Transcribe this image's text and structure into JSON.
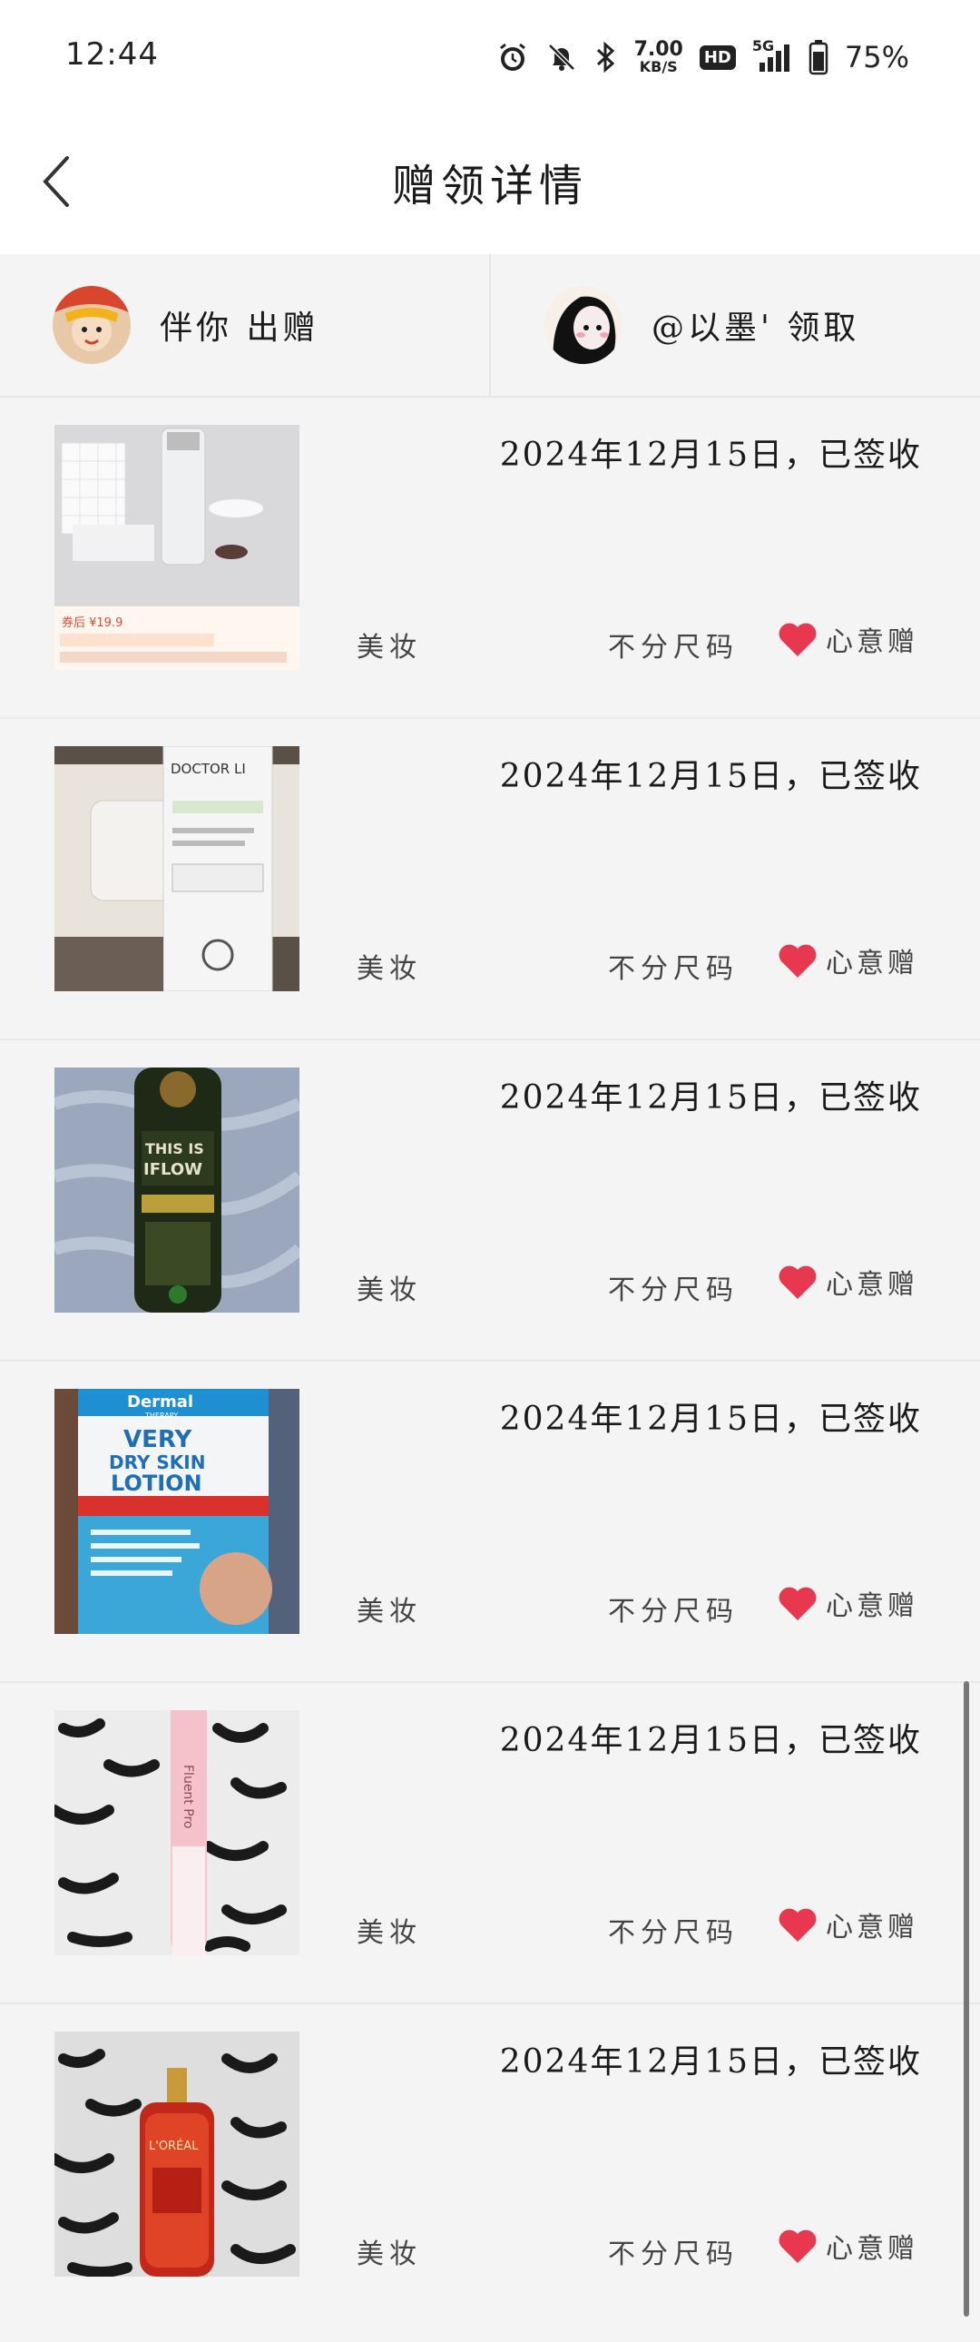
{
  "status_bar": {
    "time": "12:44",
    "speed_value": "7.00",
    "speed_unit": "KB/S",
    "hd": "HD",
    "network": "5G",
    "battery": "75%",
    "icons": [
      "alarm-icon",
      "mute-icon",
      "bluetooth-icon",
      "speed-icon",
      "hd-icon",
      "signal-icon",
      "battery-icon"
    ]
  },
  "header": {
    "title": "赠领详情",
    "back_icon": "chevron-left-icon"
  },
  "giver": {
    "text": "伴你 出赠"
  },
  "receiver": {
    "text": "@以墨' 领取"
  },
  "items": [
    {
      "date": "2024年12月15日，已签收",
      "category": "美妆",
      "size": "不分尺码",
      "gift_type": "心意赠"
    },
    {
      "date": "2024年12月15日，已签收",
      "category": "美妆",
      "size": "不分尺码",
      "gift_type": "心意赠"
    },
    {
      "date": "2024年12月15日，已签收",
      "category": "美妆",
      "size": "不分尺码",
      "gift_type": "心意赠"
    },
    {
      "date": "2024年12月15日，已签收",
      "category": "美妆",
      "size": "不分尺码",
      "gift_type": "心意赠"
    },
    {
      "date": "2024年12月15日，已签收",
      "category": "美妆",
      "size": "不分尺码",
      "gift_type": "心意赠"
    },
    {
      "date": "2024年12月15日，已签收",
      "category": "美妆",
      "size": "不分尺码",
      "gift_type": "心意赠"
    }
  ],
  "thumb_texts": {
    "doctor_li": "DOCTOR LI",
    "this_is": "THIS IS",
    "iflow": "IFLOW",
    "dermal": "Dermal",
    "therapy": "THERAPY",
    "very": "VERY",
    "dry_skin": "DRY SKIN",
    "lotion": "LOTION",
    "fluent_pro": "Fluent Pro",
    "price_tag": "券后 ¥19.9",
    "loreal": "L'ORÉAL"
  },
  "colors": {
    "accent_heart": "#e8384f",
    "background": "#f4f4f4",
    "header_bg": "#ffffff"
  }
}
